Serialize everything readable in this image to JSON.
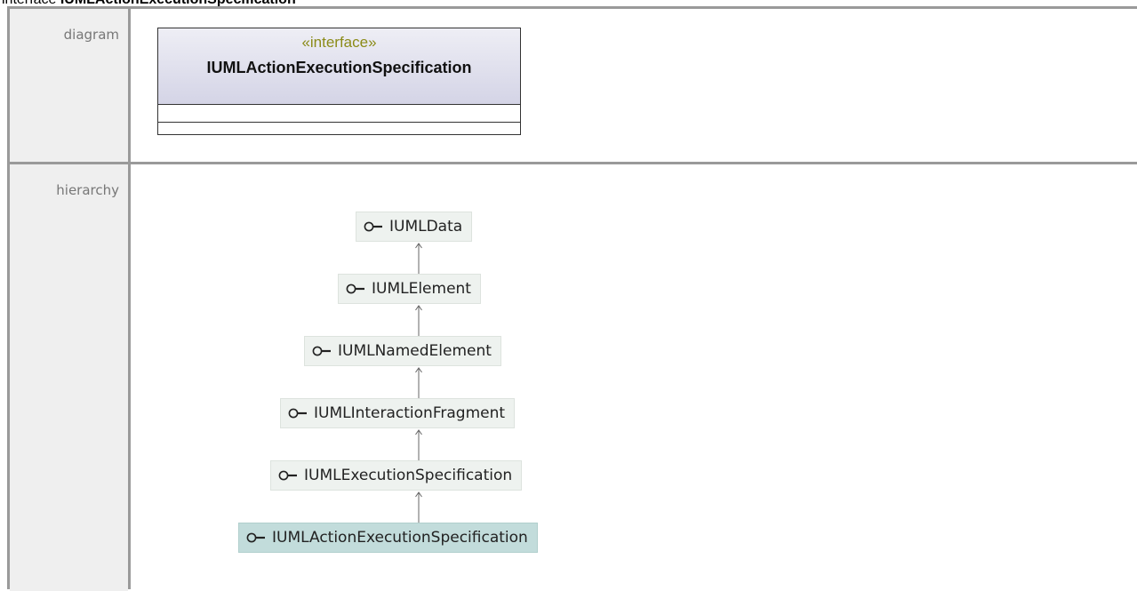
{
  "page": {
    "title_prefix": "interface ",
    "title_name": "IUMLActionExecutionSpecification"
  },
  "rows": {
    "diagram_label": "diagram",
    "hierarchy_label": "hierarchy"
  },
  "uml_box": {
    "stereotype": "«interface»",
    "name": "IUMLActionExecutionSpecification"
  },
  "hierarchy": {
    "nodes": [
      "IUMLData",
      "IUMLElement",
      "IUMLNamedElement",
      "IUMLInteractionFragment",
      "IUMLExecutionSpecification",
      "IUMLActionExecutionSpecification"
    ],
    "selected": "IUMLActionExecutionSpecification",
    "icon": "interface-lollipop-icon"
  },
  "colors": {
    "stereotype": "#8b8b18",
    "node_bg": "#eef2ef",
    "selected_node_bg": "#c2dcdb",
    "header_gradient_top": "#eeeef5",
    "header_gradient_bottom": "#d4d4e6",
    "grid_border": "#9a9a9a"
  }
}
